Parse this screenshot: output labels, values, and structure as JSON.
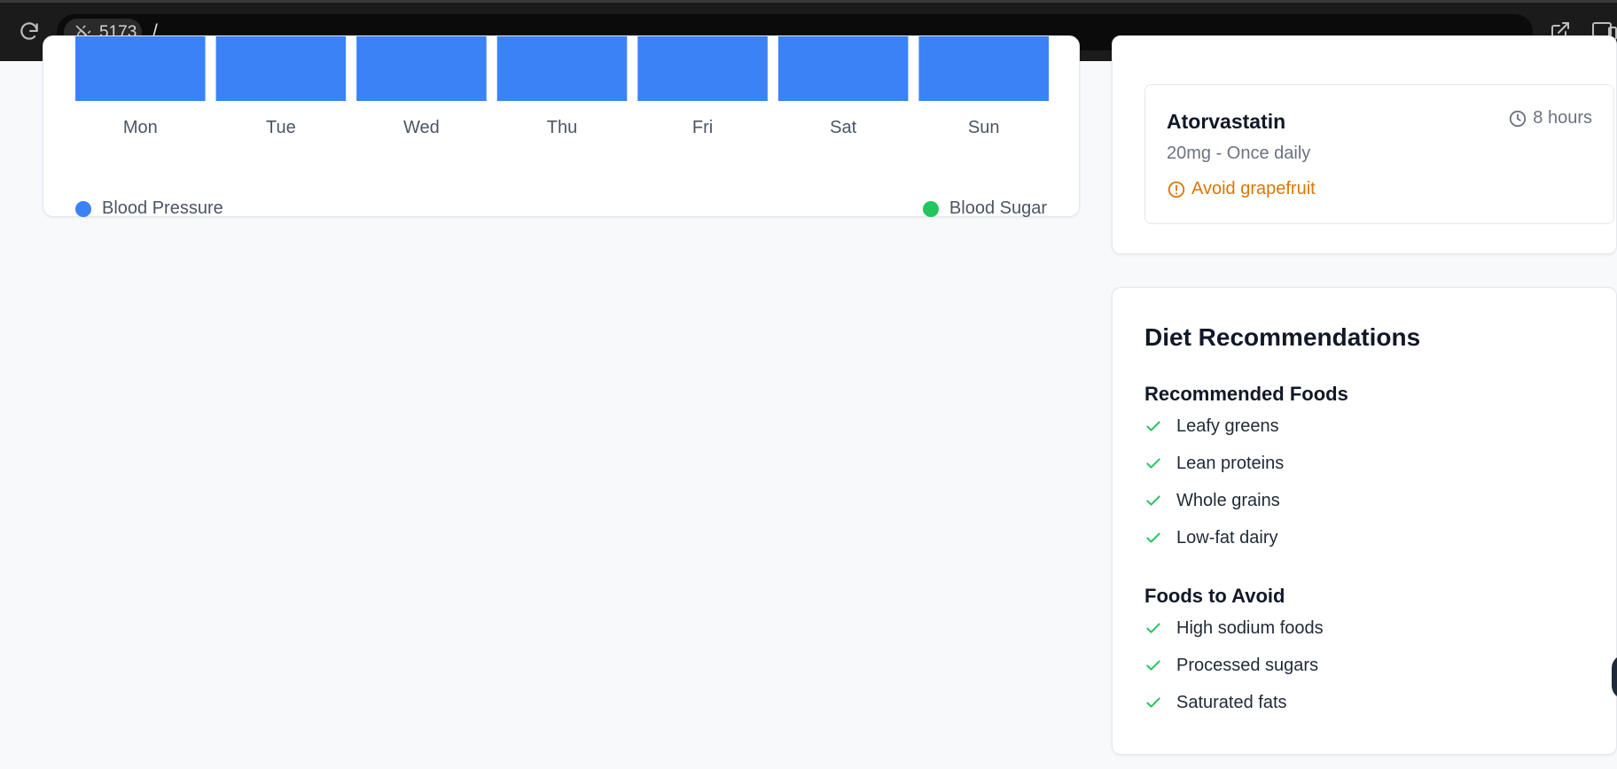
{
  "browser": {
    "port": "5173",
    "path": "/",
    "icons": [
      "reload-icon",
      "plug-off-icon",
      "external-link-icon",
      "devices-icon"
    ]
  },
  "chart_data": {
    "type": "bar",
    "categories": [
      "Mon",
      "Tue",
      "Wed",
      "Thu",
      "Fri",
      "Sat",
      "Sun"
    ],
    "series": [
      {
        "name": "Blood Pressure",
        "color": "#3b82f6"
      },
      {
        "name": "Blood Sugar",
        "color": "#22c55e"
      }
    ]
  },
  "medication": {
    "name": "Atorvastatin",
    "dose": "20mg - Once daily",
    "interval": "8 hours",
    "warning": "Avoid grapefruit",
    "warning_color": "#d97706",
    "icons": [
      "clock-icon",
      "alert-circle-icon"
    ]
  },
  "diet": {
    "title": "Diet Recommendations",
    "recommended_heading": "Recommended Foods",
    "recommended": [
      "Leafy greens",
      "Lean proteins",
      "Whole grains",
      "Low-fat dairy"
    ],
    "avoid_heading": "Foods to Avoid",
    "avoid": [
      "High sodium foods",
      "Processed sugars",
      "Saturated fats"
    ],
    "check_color": "#22c55e"
  }
}
